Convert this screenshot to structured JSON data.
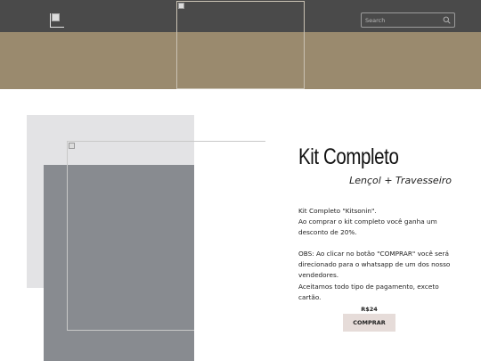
{
  "header": {
    "search": {
      "placeholder": "Search",
      "icon": "search-icon"
    },
    "logo_icon": "broken-image-icon",
    "colors": {
      "topbar": "#4a4a4a",
      "banner": "#9a8a6e"
    }
  },
  "product": {
    "title": "Kit Completo",
    "subtitle": "Lençol + Travesseiro",
    "description_lines": [
      "Kit Completo \"Kitsonin\".",
      "Ao comprar o kit completo você ganha um desconto de 20%."
    ],
    "notes": [
      "OBS: Ao clicar no botão \"COMPRAR\" você será direcionado para o whatsapp de um dos nosso vendedores.",
      "Aceitamos todo tipo de pagamento, exceto cartão."
    ],
    "price": "R$24",
    "buy_label": "COMPRAR",
    "colors": {
      "buy_button": "#e6dcd9",
      "block_light": "#e3e3e5",
      "block_dark": "#888b90"
    }
  }
}
